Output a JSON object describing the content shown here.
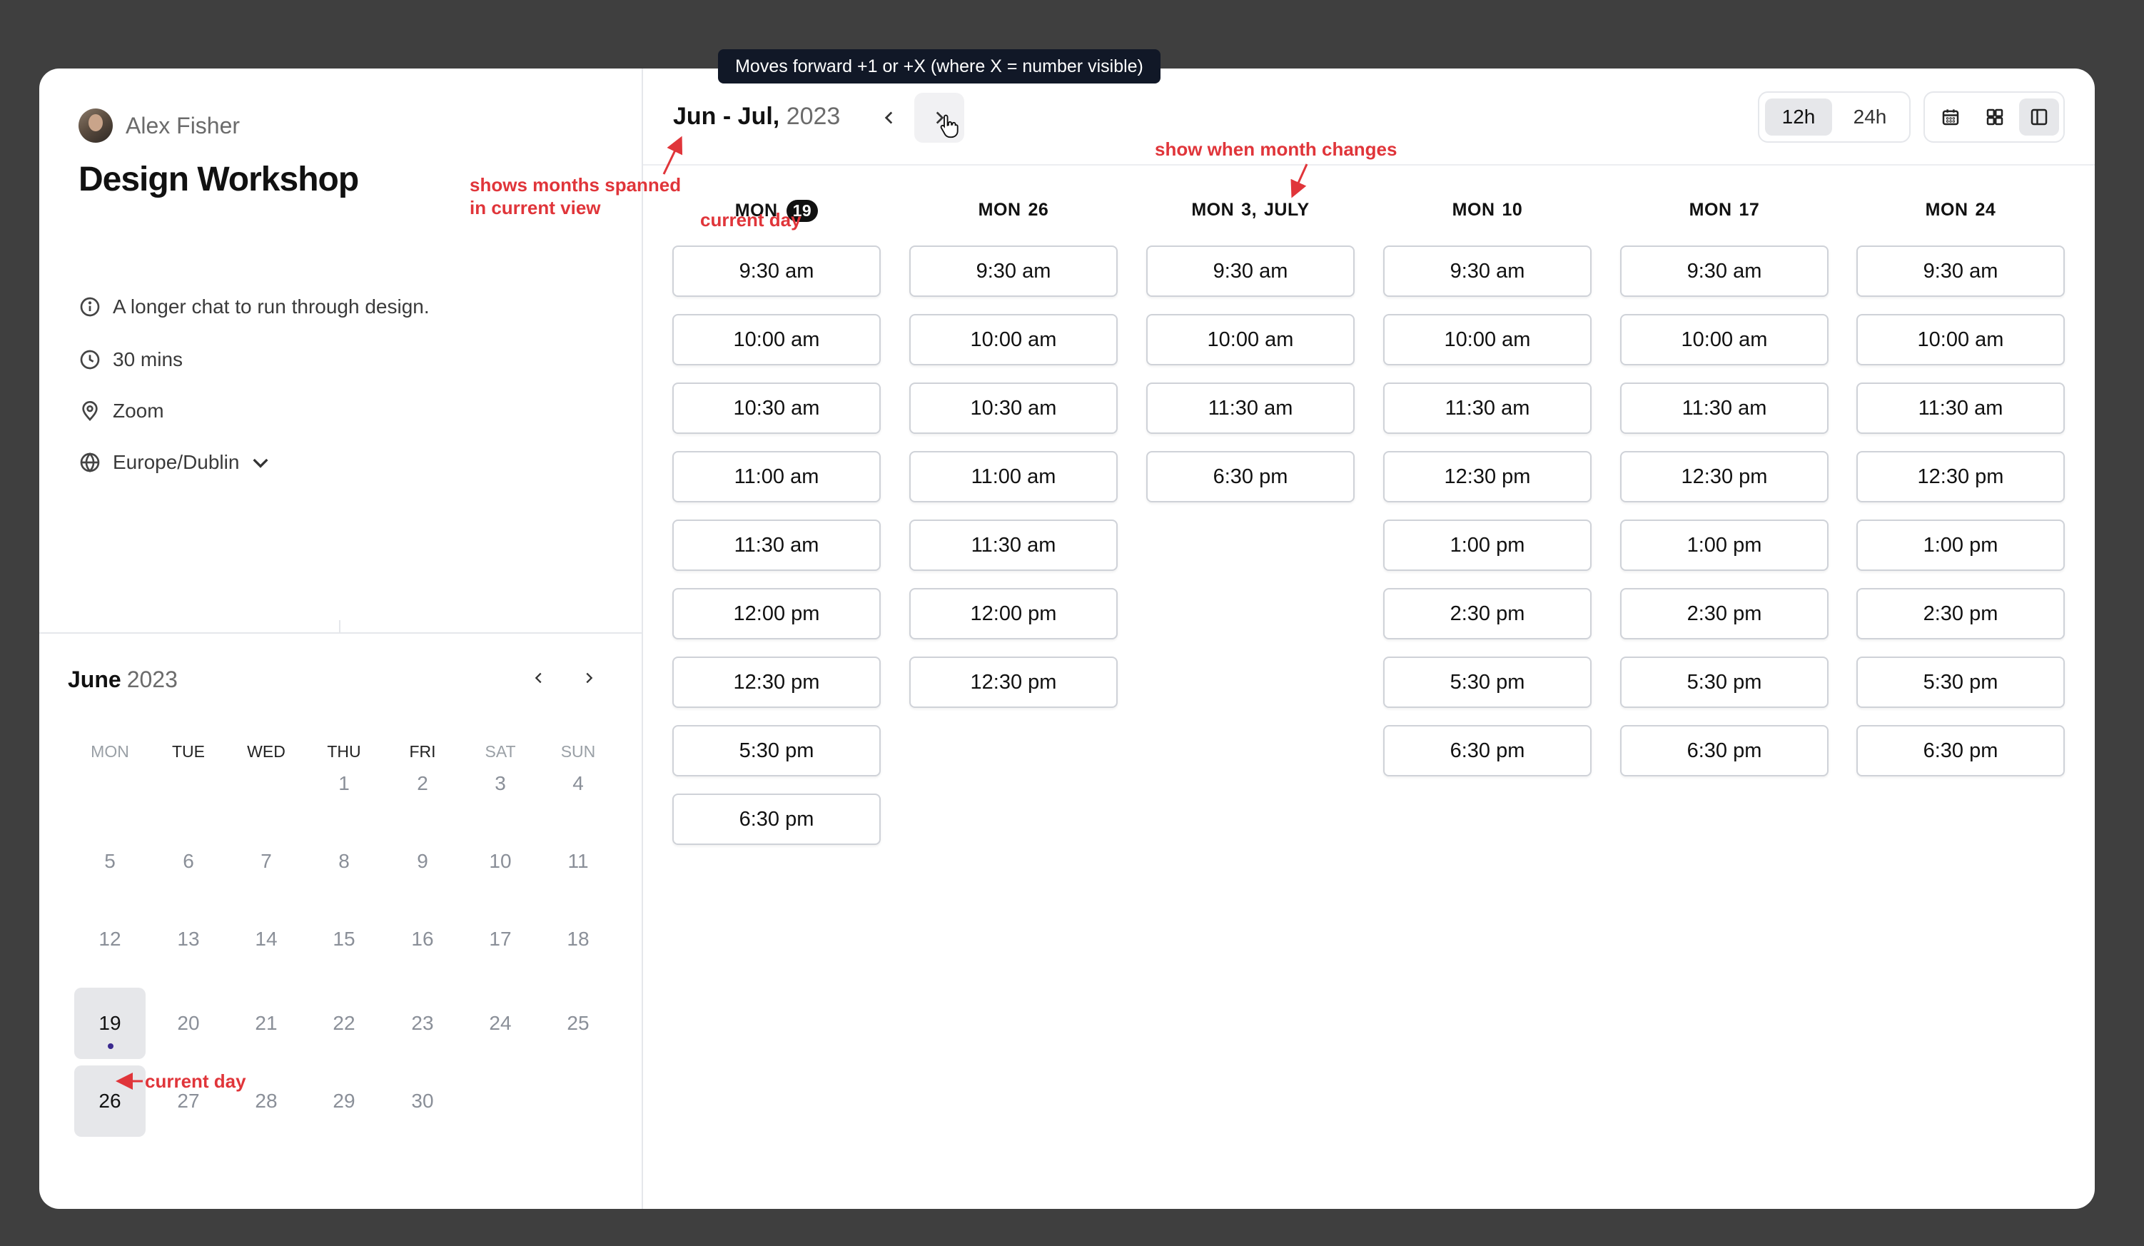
{
  "user": {
    "name": "Alex Fisher"
  },
  "event": {
    "title": "Design Workshop",
    "description": "A longer chat to run through design.",
    "duration": "30 mins",
    "location": "Zoom",
    "timezone": "Europe/Dublin"
  },
  "mini_calendar": {
    "month": "June",
    "year": "2023",
    "weekdays": [
      "MON",
      "TUE",
      "WED",
      "THU",
      "FRI",
      "SAT",
      "SUN"
    ],
    "weeks": [
      [
        "",
        "",
        "",
        "1",
        "2",
        "3",
        "4"
      ],
      [
        "5",
        "6",
        "7",
        "8",
        "9",
        "10",
        "11"
      ],
      [
        "12",
        "13",
        "14",
        "15",
        "16",
        "17",
        "18"
      ],
      [
        "19",
        "20",
        "21",
        "22",
        "23",
        "24",
        "25"
      ],
      [
        "26",
        "27",
        "28",
        "29",
        "30",
        "",
        ""
      ]
    ],
    "available_days": [
      "19",
      "26"
    ],
    "current_day": "19"
  },
  "header": {
    "range_months": "Jun - Jul,",
    "range_year": "2023",
    "format_options": [
      "12h",
      "24h"
    ],
    "format_selected": "12h",
    "views": [
      "month-view",
      "week-view",
      "column-view"
    ],
    "view_selected": "column-view"
  },
  "columns": [
    {
      "day": "MON",
      "date": "19",
      "month": "",
      "is_today": true,
      "slots": [
        "9:30 am",
        "10:00 am",
        "10:30 am",
        "11:00 am",
        "11:30 am",
        "12:00 pm",
        "12:30 pm",
        "5:30 pm",
        "6:30 pm"
      ]
    },
    {
      "day": "MON",
      "date": "26",
      "month": "",
      "slots": [
        "9:30 am",
        "10:00 am",
        "10:30 am",
        "11:00 am",
        "11:30 am",
        "12:00 pm",
        "12:30 pm"
      ]
    },
    {
      "day": "MON",
      "date": "3,",
      "month": "JULY",
      "slots": [
        "9:30 am",
        "10:00 am",
        "11:30 am",
        "6:30 pm"
      ]
    },
    {
      "day": "MON",
      "date": "10",
      "month": "",
      "slots": [
        "9:30 am",
        "10:00 am",
        "11:30 am",
        "12:30 pm",
        "1:00 pm",
        "2:30 pm",
        "5:30 pm",
        "6:30 pm"
      ]
    },
    {
      "day": "MON",
      "date": "17",
      "month": "",
      "slots": [
        "9:30 am",
        "10:00 am",
        "11:30 am",
        "12:30 pm",
        "1:00 pm",
        "2:30 pm",
        "5:30 pm",
        "6:30 pm"
      ]
    },
    {
      "day": "MON",
      "date": "24",
      "month": "",
      "slots": [
        "9:30 am",
        "10:00 am",
        "11:30 am",
        "12:30 pm",
        "1:00 pm",
        "2:30 pm",
        "5:30 pm",
        "6:30 pm"
      ]
    }
  ],
  "annotations": {
    "tooltip": "Moves forward +1 or +X (where X = number visible)",
    "months_spanned_1": "shows months spanned",
    "months_spanned_2": "in current view",
    "month_change": "show when month changes",
    "current_day_col": "current day",
    "current_day_mini": "current day"
  },
  "colors": {
    "annotation": "#e0353a",
    "tooltip_bg": "#111827",
    "selected_bg": "#e6e7ea",
    "current_day_dot": "#3b2a8f"
  }
}
